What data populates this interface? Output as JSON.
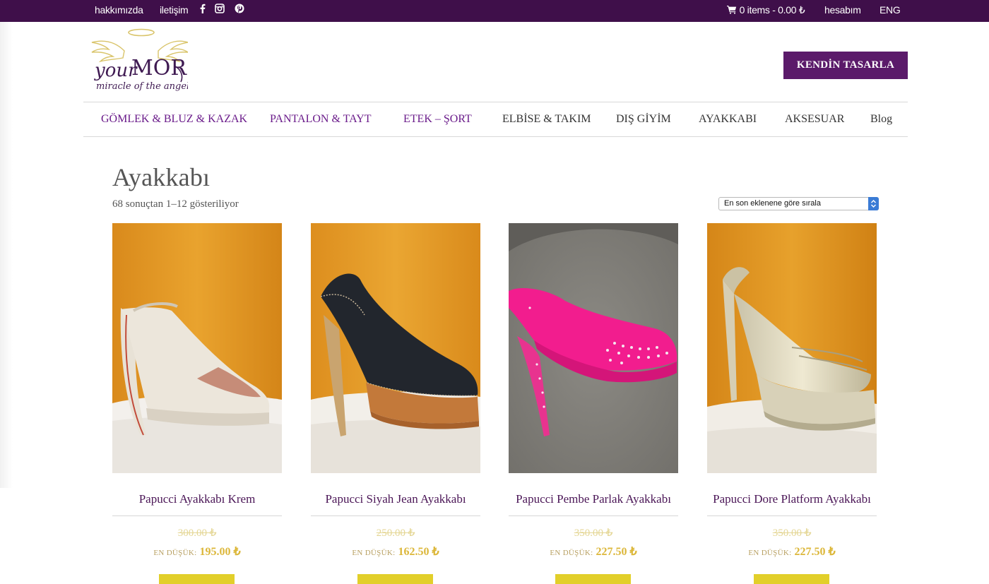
{
  "topbar": {
    "about": "hakkımızda",
    "contact": "iletişim",
    "social_icons": [
      "facebook-icon",
      "instagram-icon",
      "pinterest-icon"
    ],
    "cart_text": "0 items - 0.00 ₺",
    "account": "hesabım",
    "language": "ENG"
  },
  "header": {
    "logo_text": "yourMOR",
    "logo_tagline": "miracle of the angel",
    "cta_label": "KENDİN TASARLA"
  },
  "nav": {
    "items": [
      {
        "label": "GÖMLEK & BLUZ & KAZAK"
      },
      {
        "label": "PANTALON & TAYT"
      },
      {
        "label": "ETEK – ŞORT"
      },
      {
        "label": "ELBİSE & TAKIM"
      },
      {
        "label": "DIŞ GİYİM"
      },
      {
        "label": "AYAKKABI"
      },
      {
        "label": "AKSESUAR"
      },
      {
        "label": "Blog"
      }
    ]
  },
  "page": {
    "title": "Ayakkabı",
    "result_count": "68 sonuçtan 1–12 gösteriliyor",
    "sort_selected": "En son eklenene göre sırala"
  },
  "products": [
    {
      "name": "Papucci Ayakkabı Krem",
      "old_price": "300.00 ₺",
      "price_label": "EN DÜŞÜK:",
      "price": "195.00 ₺"
    },
    {
      "name": "Papucci Siyah Jean Ayakkabı",
      "old_price": "250.00 ₺",
      "price_label": "EN DÜŞÜK:",
      "price": "162.50 ₺"
    },
    {
      "name": "Papucci Pembe Parlak Ayakkabı",
      "old_price": "350.00 ₺",
      "price_label": "EN DÜŞÜK:",
      "price": "227.50 ₺"
    },
    {
      "name": "Papucci Dore Platform Ayakkabı",
      "old_price": "350.00 ₺",
      "price_label": "EN DÜŞÜK:",
      "price": "227.50 ₺"
    }
  ],
  "colors": {
    "topbar_bg": "#3f0f4a",
    "brand_purple": "#5b1a6a",
    "price_gold": "#dcb73a",
    "button_yellow": "#e2cf2a"
  }
}
